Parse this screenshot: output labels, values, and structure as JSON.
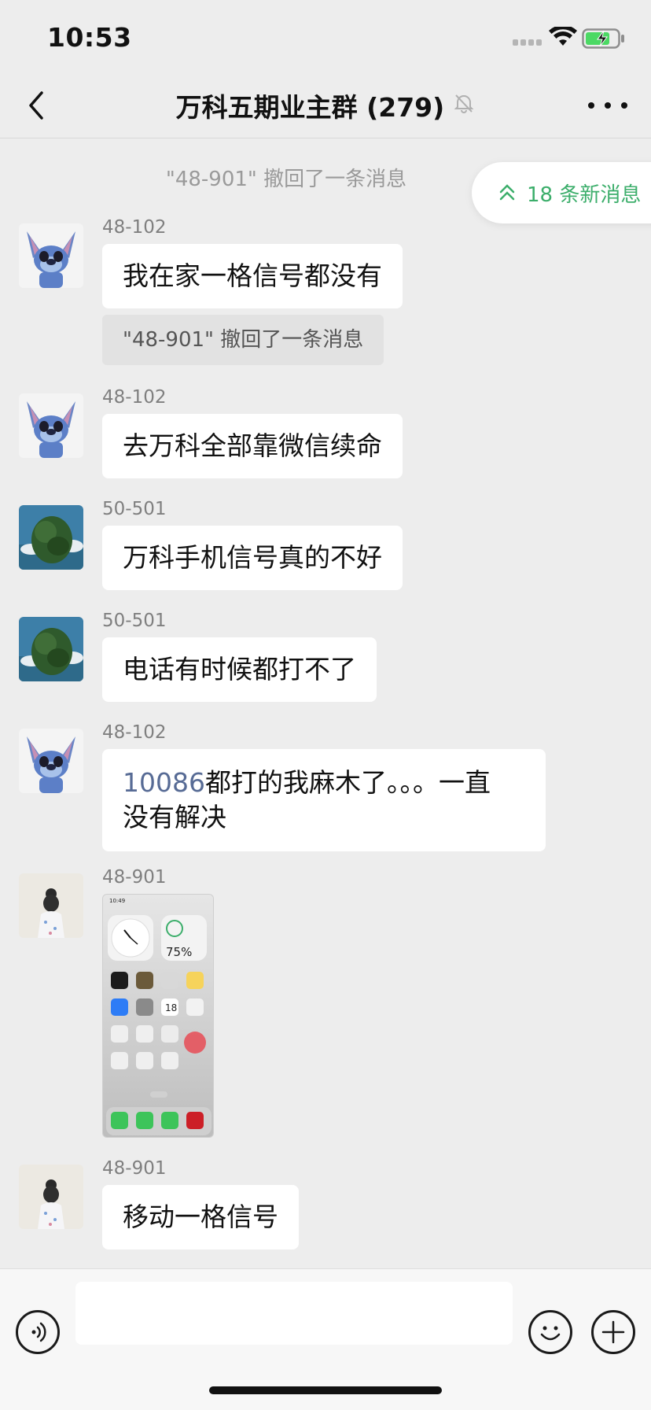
{
  "status_bar": {
    "time": "10:53",
    "battery_color": "#4cd964"
  },
  "nav": {
    "title": "万科五期业主群 (279)"
  },
  "recall_notice_top": "\"48-901\" 撤回了一条消息",
  "new_messages_pill": {
    "label": "18 条新消息",
    "color": "#3cae6b"
  },
  "messages": [
    {
      "sender": "48-102",
      "text": "我在家一格信号都没有",
      "avatar": "stitch-avatar"
    },
    {
      "recall": "\"48-901\" 撤回了一条消息"
    },
    {
      "sender": "48-102",
      "text": "去万科全部靠微信续命",
      "avatar": "stitch-avatar"
    },
    {
      "sender": "50-501",
      "text": "万科手机信号真的不好",
      "avatar": "tree-avatar"
    },
    {
      "sender": "50-501",
      "text": "电话有时候都打不了",
      "avatar": "tree-avatar"
    },
    {
      "sender": "48-102",
      "number": "10086",
      "text_line1": "都打的我麻木了。。。一直",
      "text_line2": "没有解决",
      "avatar": "stitch-avatar"
    },
    {
      "sender": "48-901",
      "image": {
        "time": "10:49",
        "battery": "75%",
        "calendar_day": "18"
      },
      "avatar": "girl-avatar"
    },
    {
      "sender": "48-901",
      "text": "移动一格信号",
      "avatar": "girl-avatar"
    }
  ],
  "input": {
    "placeholder": "",
    "value": ""
  }
}
